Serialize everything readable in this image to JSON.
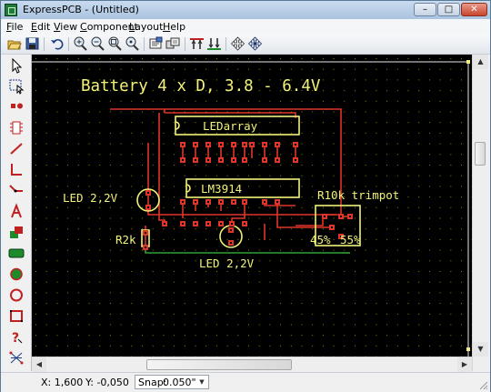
{
  "window": {
    "title": "ExpressPCB - (Untitled)"
  },
  "menu": [
    {
      "pre": "",
      "acc": "F",
      "post": "ile"
    },
    {
      "pre": "",
      "acc": "E",
      "post": "dit"
    },
    {
      "pre": "",
      "acc": "V",
      "post": "iew"
    },
    {
      "pre": "",
      "acc": "C",
      "post": "omponent"
    },
    {
      "pre": "",
      "acc": "L",
      "post": "ayout"
    },
    {
      "pre": "",
      "acc": "H",
      "post": "elp"
    }
  ],
  "schematic": {
    "title": "Battery 4 x D, 3.8 - 6.4V",
    "labels": {
      "ledarray": "LEDarray",
      "lm3914": "LM3914",
      "led_left": "LED 2,2V",
      "led_bottom": "LED 2,2V",
      "r2k": "R2k",
      "trimpot": "R10k trimpot",
      "p45": "45%",
      "p55": "55%"
    }
  },
  "status": {
    "x": "X: 1,600",
    "y": "Y: -0,050",
    "snap_label": "Snap:",
    "snap_value": "0.050\""
  },
  "colors": {
    "canvas_bg": "#000000",
    "grid": "#8a8a00",
    "trace_red": "#e0352b",
    "trace_green": "#2fa03a",
    "silkscreen": "#f2f27a"
  }
}
